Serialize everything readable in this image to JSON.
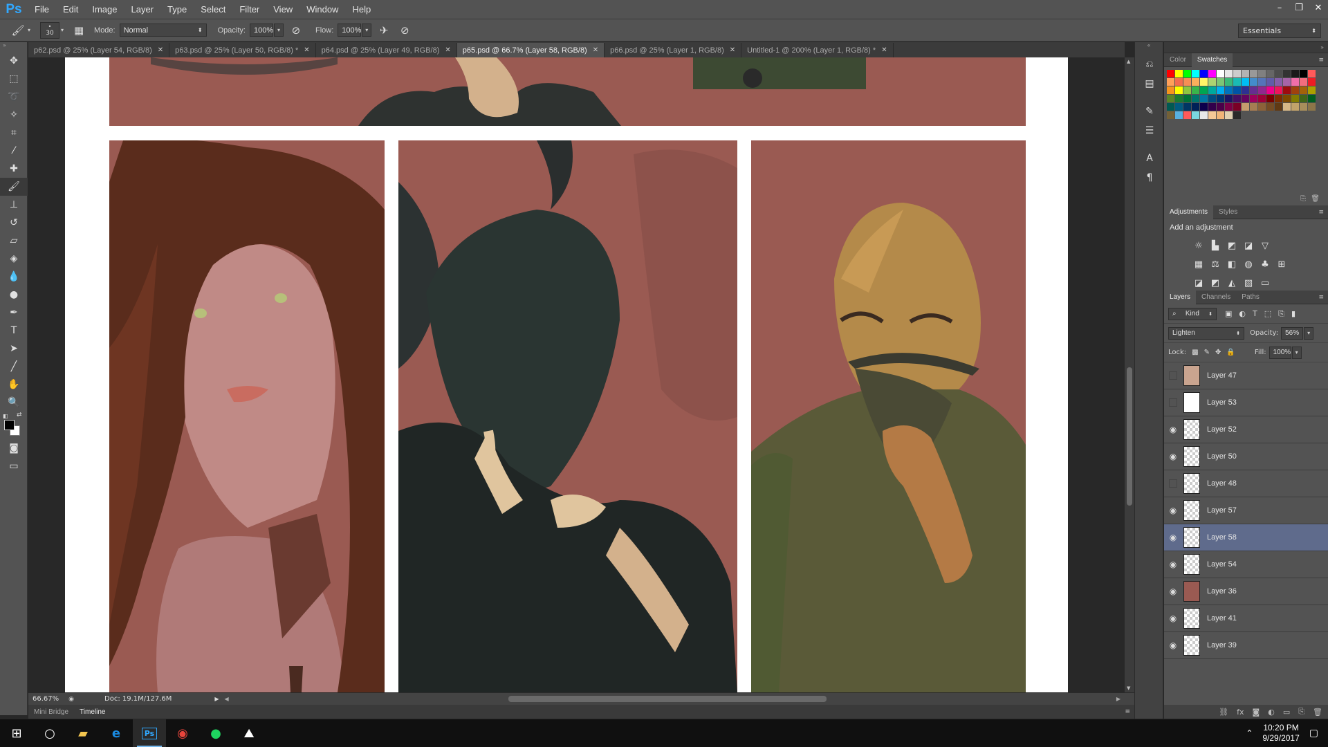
{
  "app": {
    "logo": "Ps"
  },
  "menu": [
    "File",
    "Edit",
    "Image",
    "Layer",
    "Type",
    "Select",
    "Filter",
    "View",
    "Window",
    "Help"
  ],
  "window_controls": {
    "minimize": "–",
    "restore": "❐",
    "close": "✕"
  },
  "options": {
    "brush_size": "30",
    "mode_label": "Mode:",
    "mode_value": "Normal",
    "opacity_label": "Opacity:",
    "opacity_value": "100%",
    "flow_label": "Flow:",
    "flow_value": "100%",
    "workspace": "Essentials"
  },
  "doc_tabs": [
    {
      "label": "p62.psd @ 25% (Layer 54, RGB/8)",
      "active": false
    },
    {
      "label": "p63.psd @ 25% (Layer 50, RGB/8) *",
      "active": false
    },
    {
      "label": "p64.psd @ 25% (Layer 49, RGB/8)",
      "active": false
    },
    {
      "label": "p65.psd @ 66.7% (Layer 58, RGB/8)",
      "active": true
    },
    {
      "label": "p66.psd @ 25% (Layer 1, RGB/8)",
      "active": false
    },
    {
      "label": "Untitled-1 @ 200% (Layer 1, RGB/8) *",
      "active": false
    }
  ],
  "status": {
    "zoom": "66.67%",
    "doc": "Doc: 19.1M/127.6M"
  },
  "bottom_tabs": [
    "Mini Bridge",
    "Timeline"
  ],
  "panels": {
    "color_tabs": [
      "Color",
      "Swatches"
    ],
    "adjust_tabs": [
      "Adjustments",
      "Styles"
    ],
    "adjust_title": "Add an adjustment",
    "layer_tabs": [
      "Layers",
      "Channels",
      "Paths"
    ],
    "filter_kind": "Kind",
    "blend_mode": "Lighten",
    "opacity_label": "Opacity:",
    "opacity_value": "56%",
    "lock_label": "Lock:",
    "fill_label": "Fill:",
    "fill_value": "100%"
  },
  "layers": [
    {
      "name": "Layer 47",
      "visible": false,
      "selected": false
    },
    {
      "name": "Layer 53",
      "visible": false,
      "selected": false
    },
    {
      "name": "Layer 52",
      "visible": true,
      "selected": false
    },
    {
      "name": "Layer 50",
      "visible": true,
      "selected": false
    },
    {
      "name": "Layer 48",
      "visible": false,
      "selected": false
    },
    {
      "name": "Layer 57",
      "visible": true,
      "selected": false
    },
    {
      "name": "Layer 58",
      "visible": true,
      "selected": true
    },
    {
      "name": "Layer 54",
      "visible": true,
      "selected": false
    },
    {
      "name": "Layer 36",
      "visible": true,
      "selected": false
    },
    {
      "name": "Layer 41",
      "visible": true,
      "selected": false
    },
    {
      "name": "Layer 39",
      "visible": true,
      "selected": false
    }
  ],
  "colors": {
    "accent": "#31a8ff",
    "panel_bg": "#9a5a52",
    "selected_layer": "#5f6b8c"
  },
  "taskbar": {
    "time": "10:20 PM",
    "date": "9/29/2017"
  }
}
